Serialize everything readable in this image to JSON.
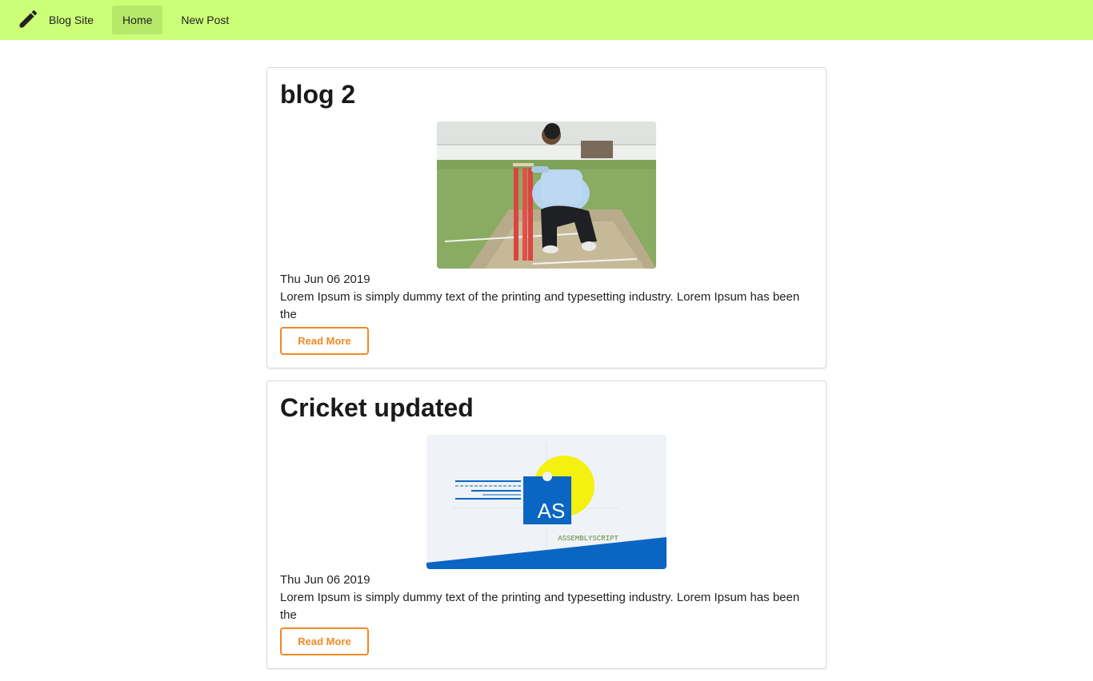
{
  "nav": {
    "brand_label": "Blog Site",
    "brand_icon": "pencil-icon",
    "items": [
      {
        "label": "Home",
        "active": true
      },
      {
        "label": "New Post",
        "active": false
      }
    ],
    "bg_color": "#ccff77"
  },
  "posts": [
    {
      "title": "blog 2",
      "image": "cricket-umpire-photo",
      "date": "Thu Jun 06 2019",
      "excerpt": "Lorem Ipsum is simply dummy text of the printing and typesetting industry. Lorem Ipsum has been the",
      "button_label": "Read More"
    },
    {
      "title": "Cricket updated",
      "image": "assemblyscript-logo",
      "image_text": "AS",
      "image_caption": "ASSEMBLYSCRIPT",
      "date": "Thu Jun 06 2019",
      "excerpt": "Lorem Ipsum is simply dummy text of the printing and typesetting industry. Lorem Ipsum has been the",
      "button_label": "Read More"
    }
  ],
  "accent_color": "#f08a24"
}
